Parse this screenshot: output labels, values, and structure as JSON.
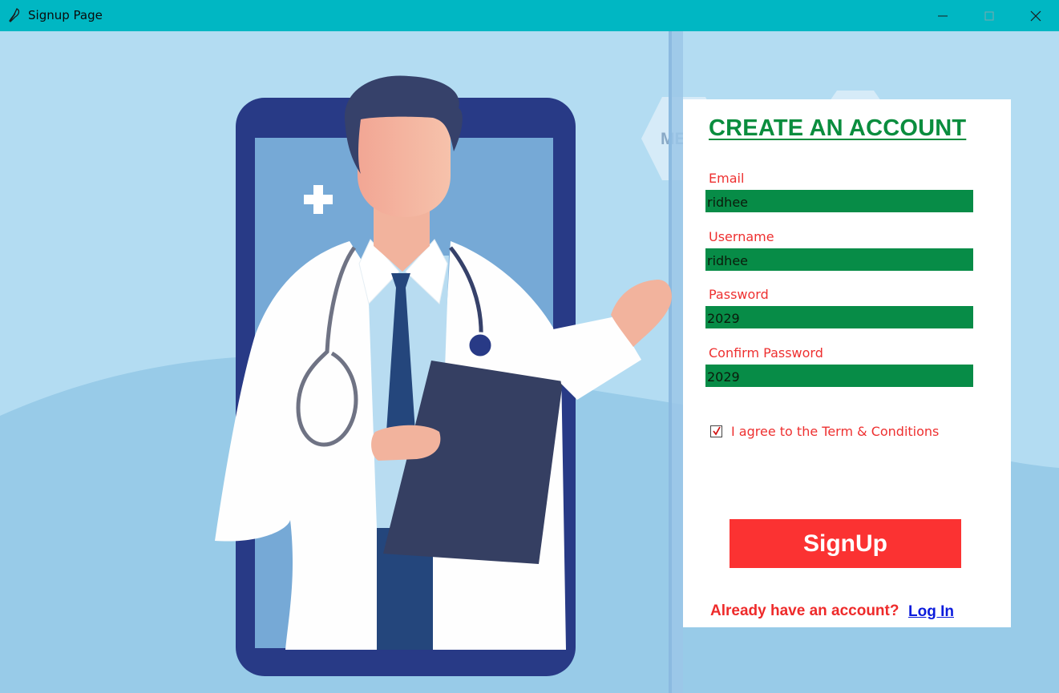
{
  "window": {
    "title": "Signup Page",
    "icon": "feather-icon",
    "title_bar_color": "#00b7c3"
  },
  "window_controls": {
    "minimize_icon": "minimize-icon",
    "maximize_icon": "maximize-icon",
    "close_icon": "close-icon"
  },
  "background": {
    "sky_color": "#b3dcf2",
    "partial_sign_text": "ME"
  },
  "form": {
    "heading": "CREATE AN ACCOUNT",
    "heading_color": "#0a8d3e",
    "fields": [
      {
        "label": "Email",
        "value": "ridhee"
      },
      {
        "label": "Username",
        "value": "ridhee"
      },
      {
        "label": "Password",
        "value": "2029"
      },
      {
        "label": "Confirm Password",
        "value": "2029"
      }
    ],
    "field_bg_color": "#078c47",
    "label_color": "#ee3030",
    "agree_checked": true,
    "agree_label": "I agree to the Term & Conditions",
    "signup_label": "SignUp",
    "signup_color": "#fb3232",
    "already_text": "Already have an account?",
    "login_label": "Log In",
    "login_color": "#0b1bdc"
  }
}
